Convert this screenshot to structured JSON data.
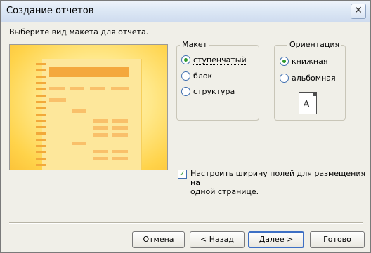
{
  "window": {
    "title": "Создание отчетов",
    "close_glyph": "✕"
  },
  "prompt": "Выберите вид макета для отчета.",
  "layout_group": {
    "legend": "Макет",
    "options": [
      {
        "label": "ступенчатый",
        "selected": true
      },
      {
        "label": "блок",
        "selected": false
      },
      {
        "label": "структура",
        "selected": false
      }
    ]
  },
  "orientation_group": {
    "legend": "Ориентация",
    "options": [
      {
        "label": "книжная",
        "selected": true
      },
      {
        "label": "альбомная",
        "selected": false
      }
    ],
    "page_letter": "A"
  },
  "adjust_checkbox": {
    "label_line1": "Настроить ширину полей для размещения на",
    "label_line2": "одной странице.",
    "checked": true,
    "check_glyph": "✓"
  },
  "buttons": {
    "cancel": "Отмена",
    "back": "< Назад",
    "next": "Далее >",
    "finish": "Готово"
  },
  "colors": {
    "accent": "#3d6fc4",
    "preview_bar": "#f4a83d",
    "radio_selected": "#2e9a2e"
  }
}
